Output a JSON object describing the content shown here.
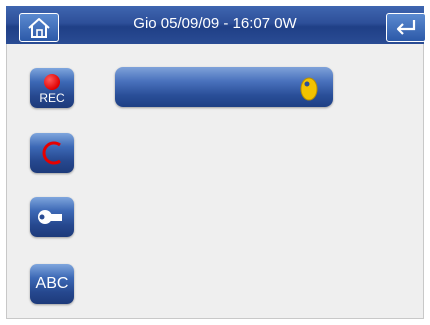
{
  "header": {
    "title": "Gio 05/09/09 - 16:07   0W",
    "home_icon": "home-icon",
    "back_icon": "return-arrow-icon"
  },
  "sidebar": {
    "rec": {
      "label": "REC",
      "icon": "record-dot-icon"
    },
    "clear": {
      "icon": "clear-c-icon"
    },
    "settings": {
      "icon": "wrench-icon"
    },
    "abc": {
      "label": "ABC"
    }
  },
  "main": {
    "field": {
      "icon": "key-icon"
    }
  },
  "colors": {
    "bar": "#2d4f99",
    "button": "#3c68b5",
    "record": "#e00000",
    "clear": "#e60000",
    "key": "#f2c200"
  }
}
